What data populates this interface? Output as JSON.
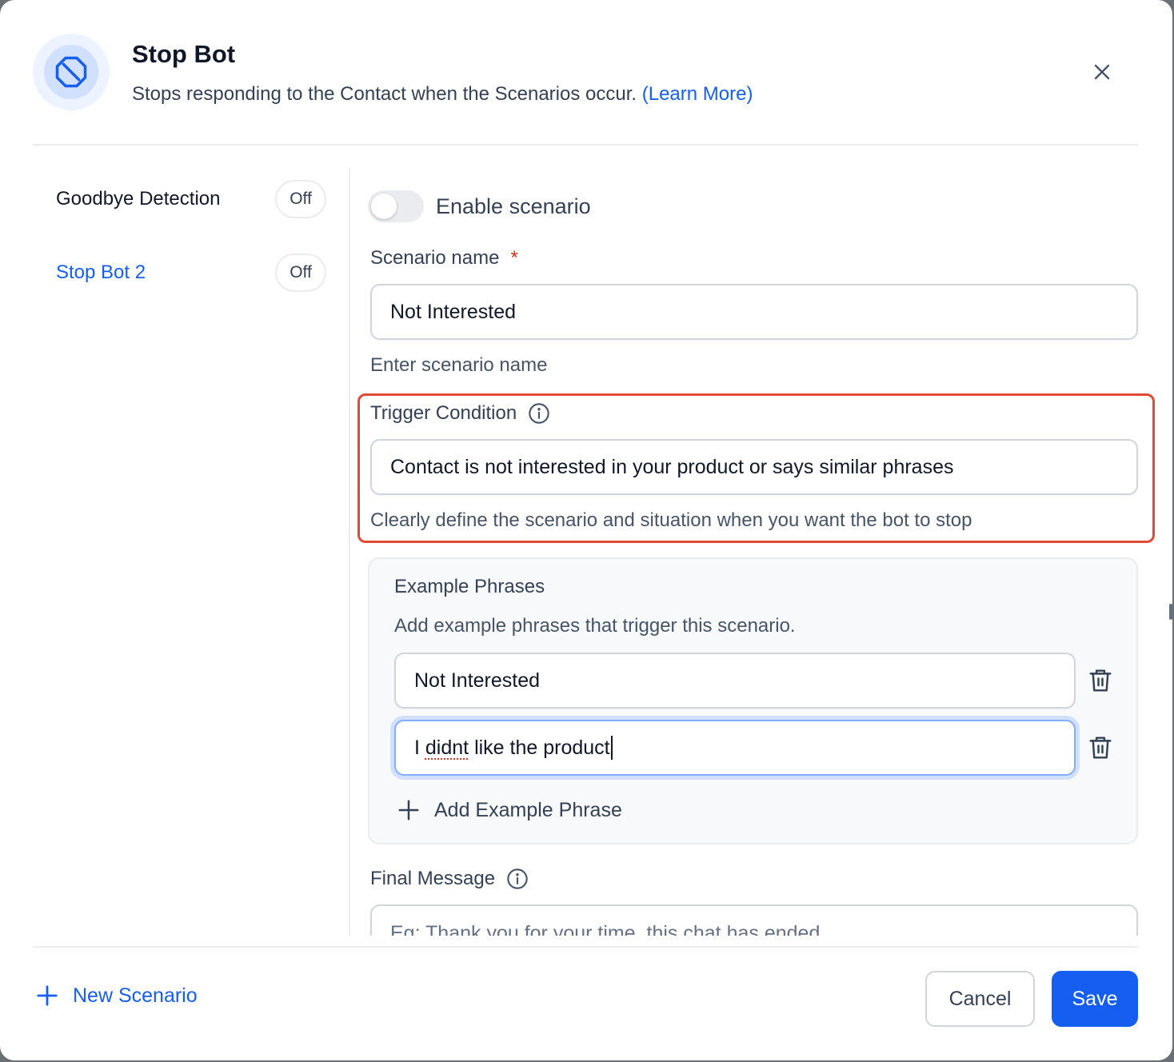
{
  "header": {
    "title": "Stop Bot",
    "subtitle": "Stops responding to the Contact when the Scenarios occur.",
    "learn_more": "(Learn More)",
    "icon": "stop-octagon-icon",
    "accent_color": "#155eef"
  },
  "sidebar": {
    "items": [
      {
        "label": "Goodbye Detection",
        "status": "Off",
        "active": false
      },
      {
        "label": "Stop Bot 2",
        "status": "Off",
        "active": true
      }
    ]
  },
  "scenario": {
    "enable_label": "Enable scenario",
    "enabled": false,
    "name_label": "Scenario name",
    "required_mark": "*",
    "name_value": "Not Interested",
    "name_helper": "Enter scenario name",
    "trigger_label": "Trigger Condition",
    "trigger_value": "Contact is not interested in your product or says similar phrases",
    "trigger_helper": "Clearly define the scenario and situation when you want the bot to stop",
    "highlight_color": "#e04a35"
  },
  "examples": {
    "title": "Example Phrases",
    "subtitle": "Add example phrases that trigger this scenario.",
    "phrases": [
      {
        "value": "Not Interested"
      },
      {
        "value_prefix": "I ",
        "value_misspelled": "didnt",
        "value_suffix": " like the product"
      }
    ],
    "add_label": "Add Example Phrase"
  },
  "final_message": {
    "label": "Final Message",
    "placeholder": "Eg: Thank you for your time, this chat has ended"
  },
  "footer": {
    "new_scenario_label": "New Scenario",
    "cancel_label": "Cancel",
    "save_label": "Save"
  }
}
